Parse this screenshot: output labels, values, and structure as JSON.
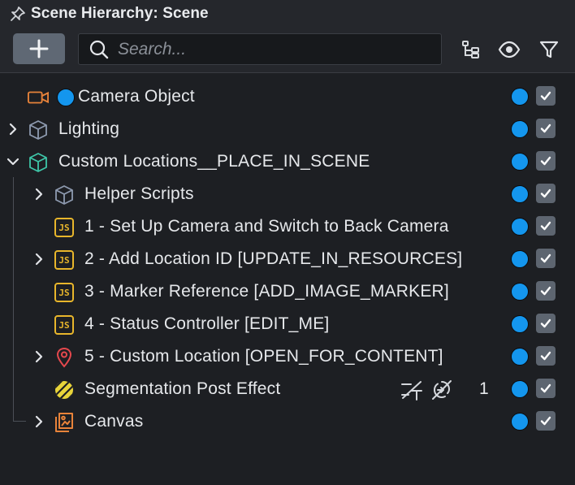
{
  "window": {
    "title": "Scene Hierarchy: Scene"
  },
  "toolbar": {
    "add_label": "+",
    "search_placeholder": "Search..."
  },
  "tree": [
    {
      "label": "Camera Object",
      "icon": "camera-icon",
      "expandable": false,
      "depth": 0,
      "visible_dot": true,
      "checked": true
    },
    {
      "label": "Lighting",
      "icon": "cube-outline-icon",
      "expandable": true,
      "expanded": false,
      "depth": 0,
      "checked": true
    },
    {
      "label": "Custom Locations__PLACE_IN_SCENE",
      "icon": "cube-teal-icon",
      "expandable": true,
      "expanded": true,
      "depth": 0,
      "checked": true
    },
    {
      "label": "Helper Scripts",
      "icon": "cube-outline-icon",
      "expandable": true,
      "expanded": false,
      "depth": 1,
      "checked": true
    },
    {
      "label": "1 - Set Up Camera and Switch to Back Camera",
      "icon": "js-script-icon",
      "expandable": false,
      "depth": 1,
      "checked": true
    },
    {
      "label": "2 - Add Location ID [UPDATE_IN_RESOURCES]",
      "icon": "js-script-icon",
      "expandable": true,
      "expanded": false,
      "depth": 1,
      "checked": true
    },
    {
      "label": "3 - Marker Reference [ADD_IMAGE_MARKER]",
      "icon": "js-script-icon",
      "expandable": false,
      "depth": 1,
      "checked": true
    },
    {
      "label": "4 - Status Controller [EDIT_ME]",
      "icon": "js-script-icon",
      "expandable": false,
      "depth": 1,
      "checked": true
    },
    {
      "label": "5 - Custom Location [OPEN_FOR_CONTENT]",
      "icon": "location-pin-icon",
      "expandable": true,
      "expanded": false,
      "depth": 1,
      "checked": true
    },
    {
      "label": "Segmentation Post Effect",
      "icon": "post-effect-icon",
      "expandable": false,
      "depth": 1,
      "checked": true,
      "count": "1"
    },
    {
      "label": "Canvas",
      "icon": "canvas-icon",
      "expandable": true,
      "expanded": false,
      "depth": 1,
      "checked": true
    }
  ],
  "colors": {
    "visible_dot": "#1496ee",
    "js_icon": "#e8b62b",
    "camera_icon": "#e8833a",
    "cube_teal": "#3ec6a8",
    "pin": "#e5484d"
  }
}
